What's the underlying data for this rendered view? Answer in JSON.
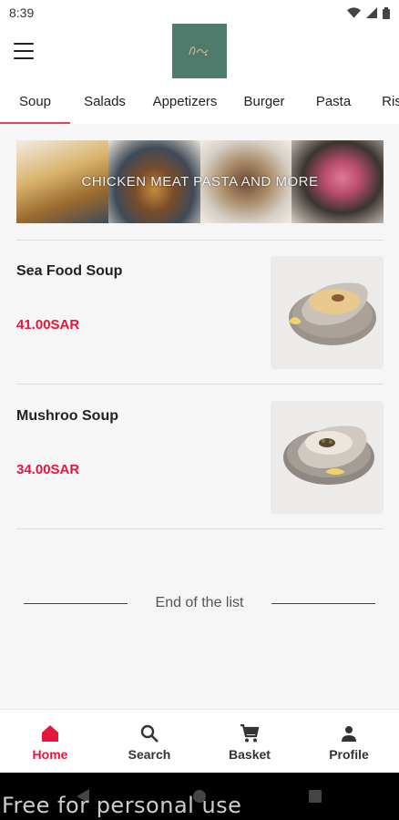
{
  "status_bar": {
    "time": "8:39"
  },
  "tabs": [
    {
      "label": "Soup",
      "active": true
    },
    {
      "label": "Salads",
      "active": false
    },
    {
      "label": "Appetizers",
      "active": false
    },
    {
      "label": "Burger",
      "active": false
    },
    {
      "label": "Pasta",
      "active": false
    },
    {
      "label": "Ris",
      "active": false
    }
  ],
  "banner": {
    "text": "CHICKEN MEAT PASTA AND MORE"
  },
  "items": [
    {
      "name": "Sea Food Soup",
      "price": "41.00SAR"
    },
    {
      "name": "Mushroo Soup",
      "price": "34.00SAR"
    }
  ],
  "end_of_list": "End of the list",
  "bottom_nav": [
    {
      "label": "Home",
      "icon": "home-icon",
      "active": true
    },
    {
      "label": "Search",
      "icon": "search-icon",
      "active": false
    },
    {
      "label": "Basket",
      "icon": "cart-icon",
      "active": false
    },
    {
      "label": "Profile",
      "icon": "person-icon",
      "active": false
    }
  ],
  "watermark": "Free for personal use",
  "colors": {
    "accent": "#e8163f",
    "tab_indicator": "#e8435a",
    "logo_bg": "#4f7b6c"
  }
}
